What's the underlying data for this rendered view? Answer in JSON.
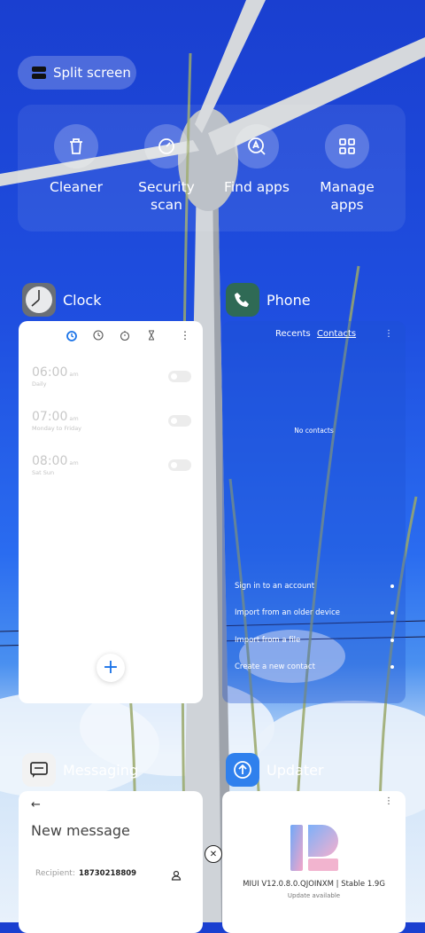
{
  "split_screen": {
    "label": "Split screen"
  },
  "tools": [
    {
      "label": "Cleaner",
      "icon": "trash-icon"
    },
    {
      "label": "Security scan",
      "icon": "shield-scan-icon"
    },
    {
      "label": "Find apps",
      "icon": "search-app-icon"
    },
    {
      "label": "Manage apps",
      "icon": "grid-icon"
    }
  ],
  "apps": {
    "clock": {
      "name": "Clock",
      "alarms": [
        {
          "time": "06:00",
          "ampm": "am",
          "repeat": "Daily"
        },
        {
          "time": "07:00",
          "ampm": "am",
          "repeat": "Monday to Friday"
        },
        {
          "time": "08:00",
          "ampm": "am",
          "repeat": "Sat Sun"
        }
      ],
      "fab": "+"
    },
    "phone": {
      "name": "Phone",
      "tabs": [
        "Recents",
        "Contacts"
      ],
      "empty": "No contacts",
      "actions": [
        "Sign in to an account",
        "Import from an older device",
        "Import from a file",
        "Create a new contact"
      ]
    },
    "messaging": {
      "name": "Messaging",
      "title": "New message",
      "recipient_label": "Recipient:",
      "recipient_value": "18730218809"
    },
    "updater": {
      "name": "Updater",
      "version": "MIUI V12.0.8.0.QJOINXM | Stable 1.9G",
      "status": "Update available"
    }
  }
}
